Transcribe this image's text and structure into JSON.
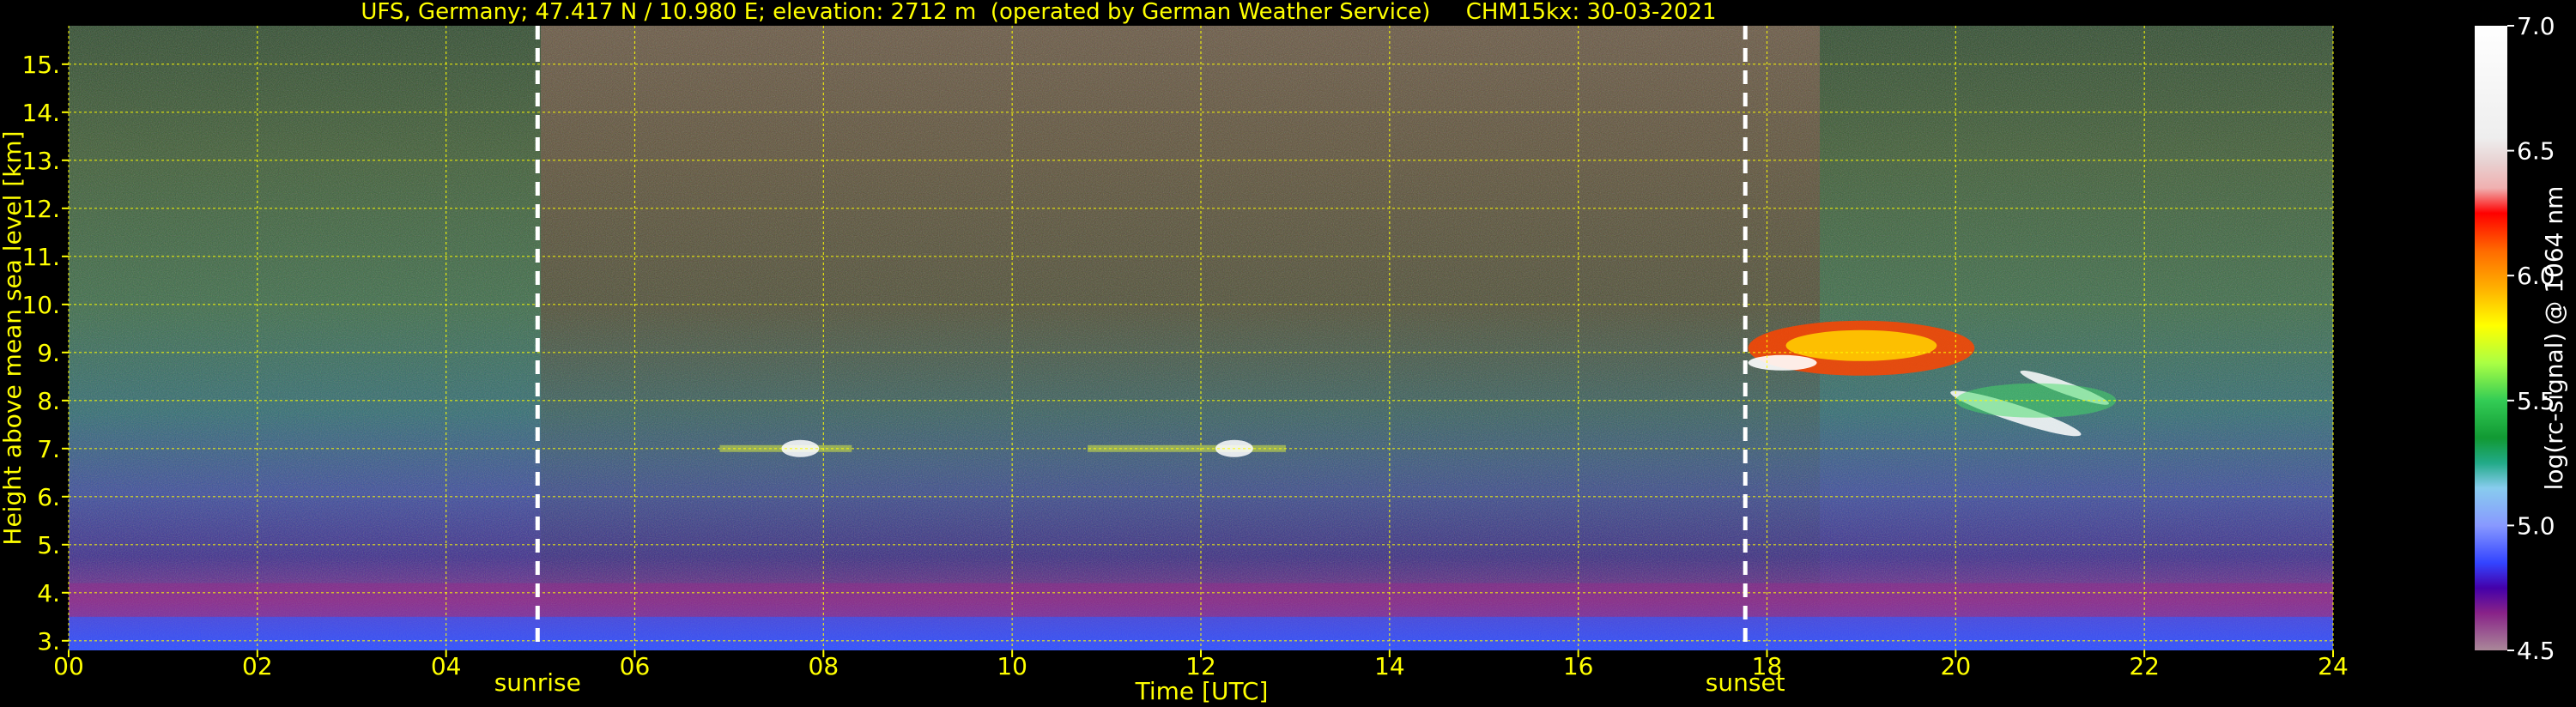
{
  "chart_data": {
    "type": "heatmap",
    "title": "UFS, Germany; 47.417 N / 10.980 E; elevation: 2712 m  (operated by German Weather Service)     CHM15kx: 30-03-2021",
    "xlabel": "Time [UTC]",
    "ylabel": "Height above mean sea level [km]",
    "xlim": [
      0,
      24
    ],
    "ylim": [
      2.8,
      15.8
    ],
    "x_ticks": [
      "00",
      "02",
      "04",
      "06",
      "08",
      "10",
      "12",
      "14",
      "16",
      "18",
      "20",
      "22",
      "24"
    ],
    "y_ticks": [
      "3.",
      "4.",
      "5.",
      "6.",
      "7.",
      "8.",
      "9.",
      "10.",
      "11.",
      "12.",
      "13.",
      "14.",
      "15."
    ],
    "grid": true,
    "markers": [
      {
        "label": "sunrise",
        "x": 4.97
      },
      {
        "label": "sunset",
        "x": 17.77
      }
    ],
    "colorbar": {
      "label": "log(rc-signal) @ 1064 nm",
      "range": [
        4.5,
        7.0
      ],
      "ticks": [
        "7.0",
        "6.5",
        "6.0",
        "5.5",
        "5.0",
        "4.5"
      ]
    },
    "features": [
      {
        "type": "cloud",
        "t_start": 6.9,
        "t_end": 8.3,
        "height_km": 7.0
      },
      {
        "type": "cloud",
        "t_start": 10.8,
        "t_end": 12.9,
        "height_km": 7.0
      },
      {
        "type": "cloud",
        "t_start": 17.8,
        "t_end": 20.2,
        "height_km": 9.0
      },
      {
        "type": "cloud",
        "t_start": 20.0,
        "t_end": 21.7,
        "height_km": 8.0
      },
      {
        "type": "aerosol_layer",
        "t_start": 0,
        "t_end": 24,
        "height_km": 3.2
      }
    ]
  }
}
